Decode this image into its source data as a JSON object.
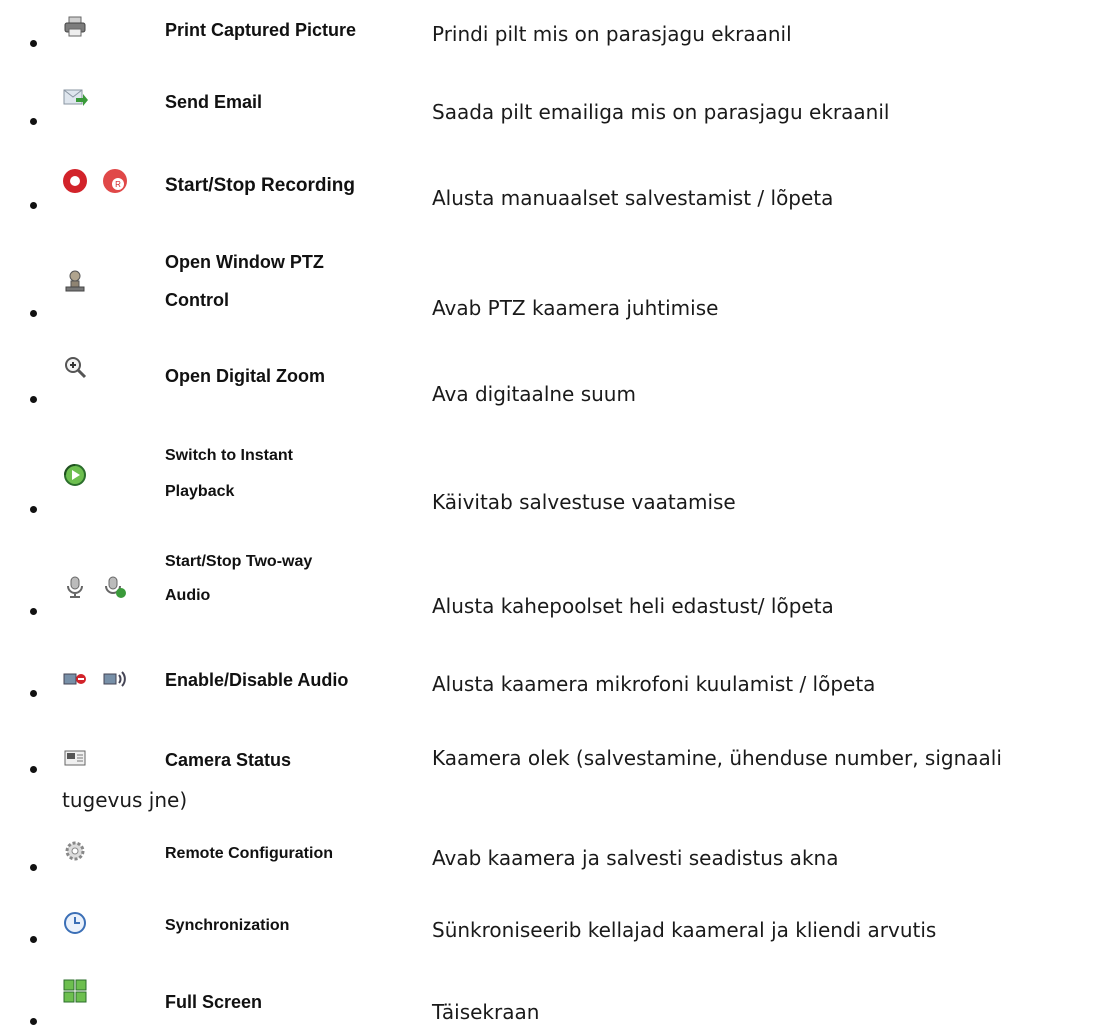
{
  "items": [
    {
      "icon": [
        "printer-icon"
      ],
      "label": "Print Captured Picture",
      "desc": "Prindi pilt mis on parasjagu ekraanil"
    },
    {
      "icon": [
        "send-email-icon"
      ],
      "label": "Send Email",
      "desc": "Saada pilt emailiga mis on parasjagu ekraanil"
    },
    {
      "icon": [
        "record-start-icon",
        "record-stop-icon"
      ],
      "label": "Start/Stop Recording",
      "desc": "Alusta manuaalset salvestamist / lõpeta"
    },
    {
      "icon": [
        "ptz-control-icon"
      ],
      "label_lines": [
        "Open Window PTZ",
        "Control"
      ],
      "desc": "Avab PTZ kaamera juhtimise"
    },
    {
      "icon": [
        "digital-zoom-icon"
      ],
      "label": "Open Digital Zoom",
      "desc": "Ava digitaalne suum"
    },
    {
      "icon": [
        "instant-playback-icon"
      ],
      "label_lines": [
        "Switch to Instant",
        "Playback"
      ],
      "desc": "Käivitab salvestuse vaatamise"
    },
    {
      "icon": [
        "microphone-icon",
        "microphone-active-icon"
      ],
      "label_lines": [
        "Start/Stop Two-way",
        "Audio"
      ],
      "desc": "Alusta kahepoolset heli edastust/ lõpeta"
    },
    {
      "icon": [
        "audio-disabled-icon",
        "audio-enabled-icon"
      ],
      "label": "Enable/Disable Audio",
      "desc": "Alusta kaamera mikrofoni kuulamist / lõpeta"
    },
    {
      "icon": [
        "camera-status-icon"
      ],
      "label": "Camera Status",
      "desc": "Kaamera olek (salvestamine, ühenduse number, signaali",
      "desc_cont": "tugevus jne)"
    },
    {
      "icon": [
        "gear-icon"
      ],
      "label": "Remote Configuration",
      "desc": "Avab kaamera ja salvesti seadistus akna"
    },
    {
      "icon": [
        "clock-sync-icon"
      ],
      "label": "Synchronization",
      "desc": "Sünkroniseerib kellajad kaameral ja kliendi arvutis"
    },
    {
      "icon": [
        "full-screen-icon"
      ],
      "label": "Full Screen",
      "desc": "Täisekraan"
    }
  ],
  "colors": {
    "record_red": "#d2232a",
    "green": "#3a9a3a",
    "gray": "#8a8a8a",
    "blue": "#3b6fb6"
  }
}
